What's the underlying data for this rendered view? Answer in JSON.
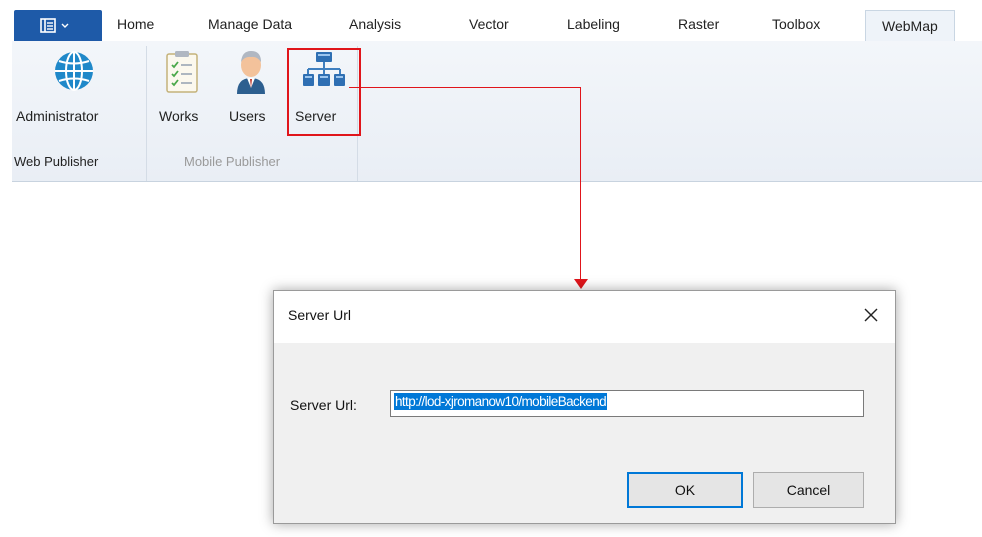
{
  "ribbon": {
    "tabs": [
      "Home",
      "Manage Data",
      "Analysis",
      "Vector",
      "Labeling",
      "Raster",
      "Toolbox",
      "WebMap"
    ],
    "active_tab": "WebMap",
    "file_menu_icon": "application-menu-icon",
    "groups": {
      "web_publisher": {
        "label": "Web Publisher",
        "buttons": [
          {
            "label": "Administrator",
            "icon": "globe-icon"
          }
        ]
      },
      "mobile_publisher": {
        "label": "Mobile Publisher",
        "buttons": [
          {
            "label": "Works",
            "icon": "checklist-icon"
          },
          {
            "label": "Users",
            "icon": "user-icon"
          },
          {
            "label": "Server",
            "icon": "network-server-icon"
          }
        ]
      }
    }
  },
  "dialog": {
    "title": "Server Url",
    "field_label": "Server Url:",
    "field_value": "http://lod-xjromanow10/mobileBackend",
    "ok_label": "OK",
    "cancel_label": "Cancel",
    "close_icon": "close-icon"
  },
  "colors": {
    "highlight": "#e0151b",
    "accent": "#1e5aa8",
    "selection": "#0078d7"
  }
}
